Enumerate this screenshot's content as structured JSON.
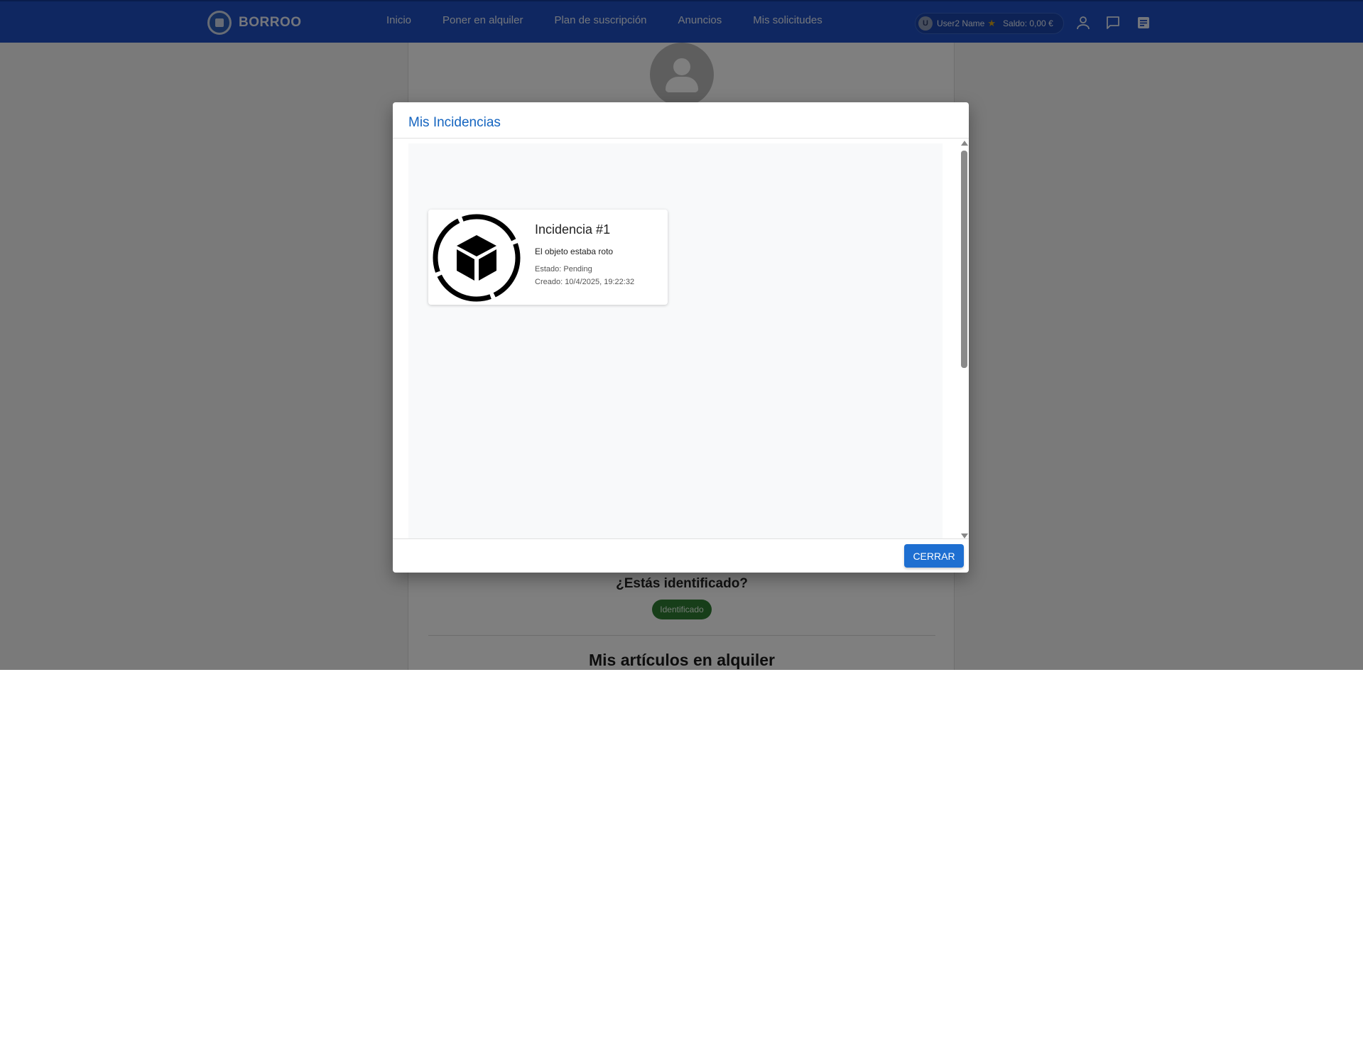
{
  "navbar": {
    "brand": "BORROO",
    "links": [
      "Inicio",
      "Poner en alquiler",
      "Plan de suscripción",
      "Anuncios",
      "Mis solicitudes"
    ],
    "user": {
      "initial": "U",
      "name": "User2 Name",
      "balance": "Saldo: 0,00 €"
    },
    "icons": [
      "user-icon",
      "chat-icon",
      "notes-icon"
    ]
  },
  "page": {
    "identified_question": "¿Estás identificado?",
    "identified_chip": "Identificado",
    "section_title": "Mis artículos en alquiler"
  },
  "modal": {
    "title": "Mis Incidencias",
    "close_label": "CERRAR",
    "incidents": [
      {
        "title": "Incidencia #1",
        "description": "El objeto estaba roto",
        "status": "Estado: Pending",
        "created": "Creado: 10/4/2025, 19:22:32"
      }
    ]
  },
  "colors": {
    "navbar": "#1e4fc2",
    "accent": "#1565c0",
    "button": "#1e6fd1",
    "chip_ok": "#2e7d32"
  }
}
